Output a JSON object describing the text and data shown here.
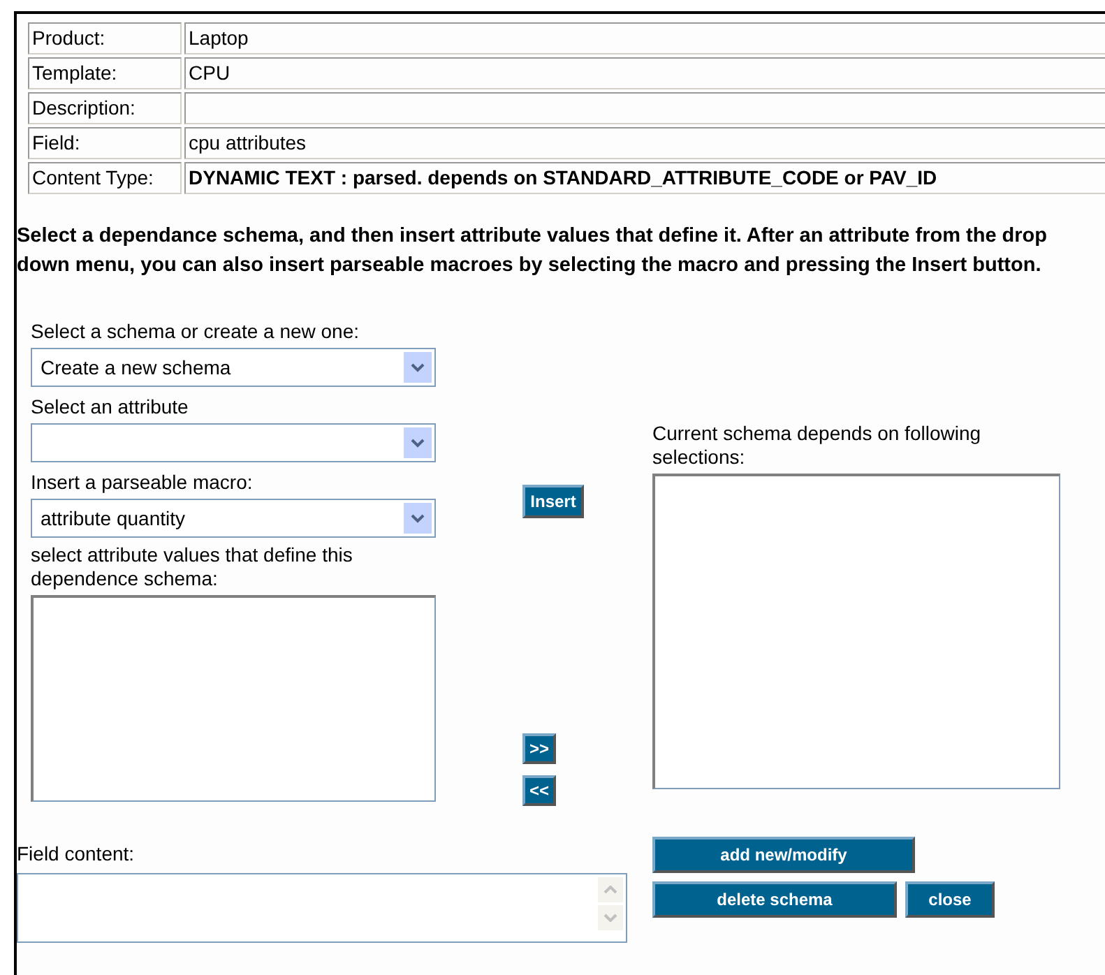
{
  "info_table": [
    {
      "label": "Product:",
      "value": "Laptop"
    },
    {
      "label": "Template:",
      "value": "CPU"
    },
    {
      "label": "Description:"
    },
    {
      "label": "Field:",
      "value": "cpu attributes"
    },
    {
      "label": "Content Type:",
      "value": "DYNAMIC TEXT : parsed. depends on STANDARD_ATTRIBUTE_CODE or PAV_ID",
      "bold": true
    }
  ],
  "instructions": "Select a dependance schema, and then insert attribute values that define it. After an attribute from the drop down menu, you can also insert parseable macroes by selecting the macro and pressing the Insert button.",
  "schema_select": {
    "label": "Select a schema or create a new one:",
    "value": "Create a new schema"
  },
  "attribute_select": {
    "label": "Select an attribute"
  },
  "macro_select": {
    "label": "Insert a parseable macro:",
    "value": "attribute quantity"
  },
  "values_list": {
    "label": "select attribute values that define this dependence schema:"
  },
  "insert_button": "Insert",
  "add_button": ">>",
  "remove_button": "<<",
  "current_schema": {
    "label": "Current schema depends on following selections:"
  },
  "field_content": {
    "label": "Field content:"
  },
  "buttons": {
    "add_modify": "add new/modify",
    "delete_schema": "delete schema",
    "close": "close"
  }
}
